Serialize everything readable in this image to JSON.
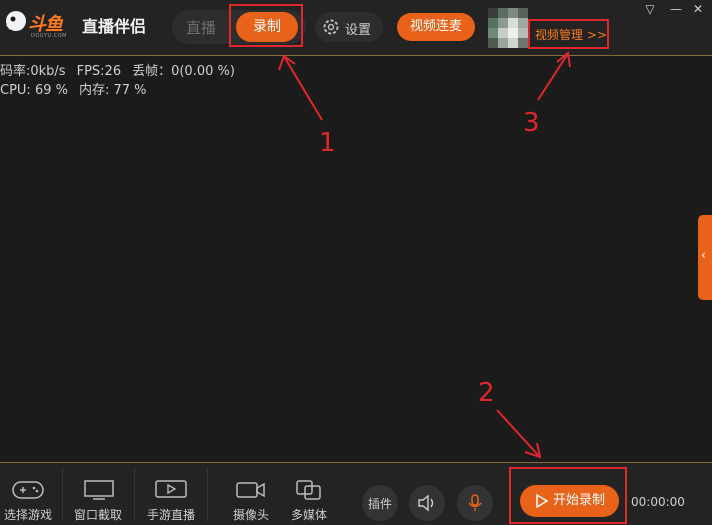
{
  "header": {
    "brand": "斗鱼",
    "brand_domain": "DOUYU.COM",
    "product": "直播伴侣",
    "tabs": {
      "live": "直播",
      "record": "录制"
    },
    "settings_label": "设置",
    "video_link_label": "视频连麦",
    "video_manage_label": "视频管理 >>"
  },
  "stats": {
    "bitrate": "码率:0kb/s",
    "fps": "FPS:26",
    "dropped": "丢帧：0(0.00 %)",
    "cpu": "CPU: 69 %",
    "memory": "内存: 77 %"
  },
  "annotations": {
    "a1": "1",
    "a2": "2",
    "a3": "3"
  },
  "toolbar": {
    "select_game": "选择游戏",
    "window_capture": "窗口截取",
    "mobile_live": "手游直播",
    "camera": "摄像头",
    "multimedia": "多媒体",
    "plugin": "插件",
    "start_record": "开始录制",
    "timer": "00:00:00"
  },
  "colors": {
    "accent": "#e8621a",
    "highlight": "#e0272d",
    "background": "#1b1b1b"
  }
}
